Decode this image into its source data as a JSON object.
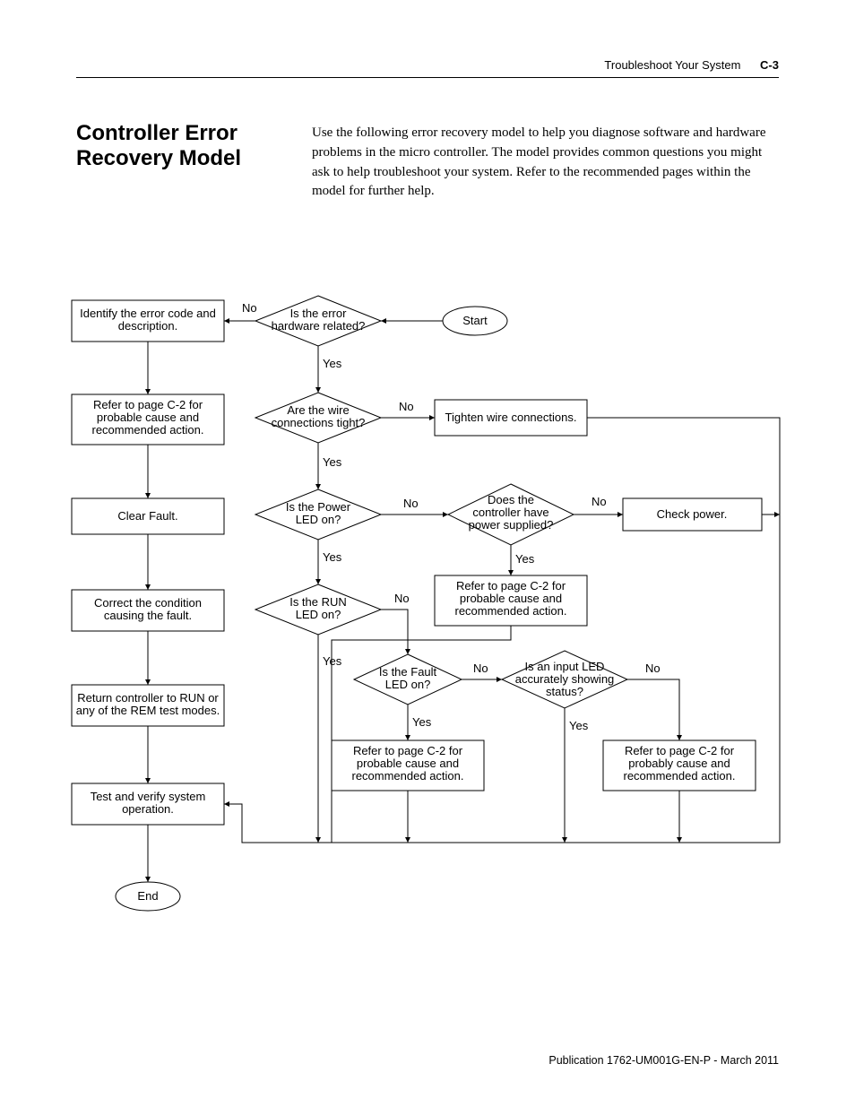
{
  "header": {
    "section": "Troubleshoot Your System",
    "page": "C-3"
  },
  "title": "Controller Error Recovery Model",
  "intro": "Use the following error recovery model to help you diagnose software and hardware problems in the micro controller. The model provides common questions you might ask to help troubleshoot your system. Refer to the recommended pages within the model for further help.",
  "footer": "Publication 1762-UM001G-EN-P - March 2011",
  "chart_data": {
    "type": "flowchart",
    "nodes": {
      "start": {
        "kind": "terminator",
        "text": "Start"
      },
      "d_hw": {
        "kind": "decision",
        "text": "Is the error hardware related?"
      },
      "b_ident": {
        "kind": "process",
        "text": "Identify the error code and description."
      },
      "b_refer1": {
        "kind": "process",
        "text": "Refer to page C-2 for probable cause and recommended action."
      },
      "b_clear": {
        "kind": "process",
        "text": "Clear Fault."
      },
      "b_corr": {
        "kind": "process",
        "text": "Correct the condition causing the fault."
      },
      "b_run": {
        "kind": "process",
        "text": "Return controller to RUN or any of the REM test modes."
      },
      "b_test": {
        "kind": "process",
        "text": "Test and verify system operation."
      },
      "end": {
        "kind": "terminator",
        "text": "End"
      },
      "d_wire": {
        "kind": "decision",
        "text": "Are the wire connections tight?"
      },
      "b_tight": {
        "kind": "process",
        "text": "Tighten wire connections."
      },
      "d_pwrled": {
        "kind": "decision",
        "text": "Is the Power LED on?"
      },
      "d_pwrsup": {
        "kind": "decision",
        "text": "Does the controller have power supplied?"
      },
      "b_chkpwr": {
        "kind": "process",
        "text": "Check power."
      },
      "b_refer2": {
        "kind": "process",
        "text": "Refer to page C-2 for probable cause and recommended action."
      },
      "d_runled": {
        "kind": "decision",
        "text": "Is the RUN LED on?"
      },
      "d_fault": {
        "kind": "decision",
        "text": "Is the Fault LED on?"
      },
      "d_input": {
        "kind": "decision",
        "text": "Is an input LED accurately showing status?"
      },
      "b_refer3": {
        "kind": "process",
        "text": "Refer to page C-2 for probable cause and recommended action."
      },
      "b_refer4": {
        "kind": "process",
        "text": "Refer to page C-2 for probably cause and recommended action."
      }
    },
    "edges": [
      {
        "from": "start",
        "to": "d_hw"
      },
      {
        "from": "d_hw",
        "to": "b_ident",
        "label": "No"
      },
      {
        "from": "d_hw",
        "to": "d_wire",
        "label": "Yes"
      },
      {
        "from": "b_ident",
        "to": "b_refer1"
      },
      {
        "from": "b_refer1",
        "to": "b_clear"
      },
      {
        "from": "b_clear",
        "to": "b_corr"
      },
      {
        "from": "b_corr",
        "to": "b_run"
      },
      {
        "from": "b_run",
        "to": "b_test"
      },
      {
        "from": "b_test",
        "to": "end"
      },
      {
        "from": "d_wire",
        "to": "b_tight",
        "label": "No"
      },
      {
        "from": "d_wire",
        "to": "d_pwrled",
        "label": "Yes"
      },
      {
        "from": "b_tight",
        "to": "b_test"
      },
      {
        "from": "d_pwrled",
        "to": "d_pwrsup",
        "label": "No"
      },
      {
        "from": "d_pwrled",
        "to": "d_runled",
        "label": "Yes"
      },
      {
        "from": "d_pwrsup",
        "to": "b_chkpwr",
        "label": "No"
      },
      {
        "from": "d_pwrsup",
        "to": "b_refer2",
        "label": "Yes"
      },
      {
        "from": "b_chkpwr",
        "to": "b_test"
      },
      {
        "from": "b_refer2",
        "to": "b_test"
      },
      {
        "from": "d_runled",
        "to": "d_fault",
        "label": "No"
      },
      {
        "from": "d_runled",
        "to": "b_test",
        "label": "Yes"
      },
      {
        "from": "d_fault",
        "to": "d_input",
        "label": "No"
      },
      {
        "from": "d_fault",
        "to": "b_refer3",
        "label": "Yes"
      },
      {
        "from": "d_input",
        "to": "b_refer4",
        "label": "No"
      },
      {
        "from": "d_input",
        "to": "b_test",
        "label": "Yes"
      },
      {
        "from": "b_refer3",
        "to": "b_test"
      },
      {
        "from": "b_refer4",
        "to": "b_test"
      }
    ],
    "labels": {
      "yes": "Yes",
      "no": "No"
    }
  }
}
